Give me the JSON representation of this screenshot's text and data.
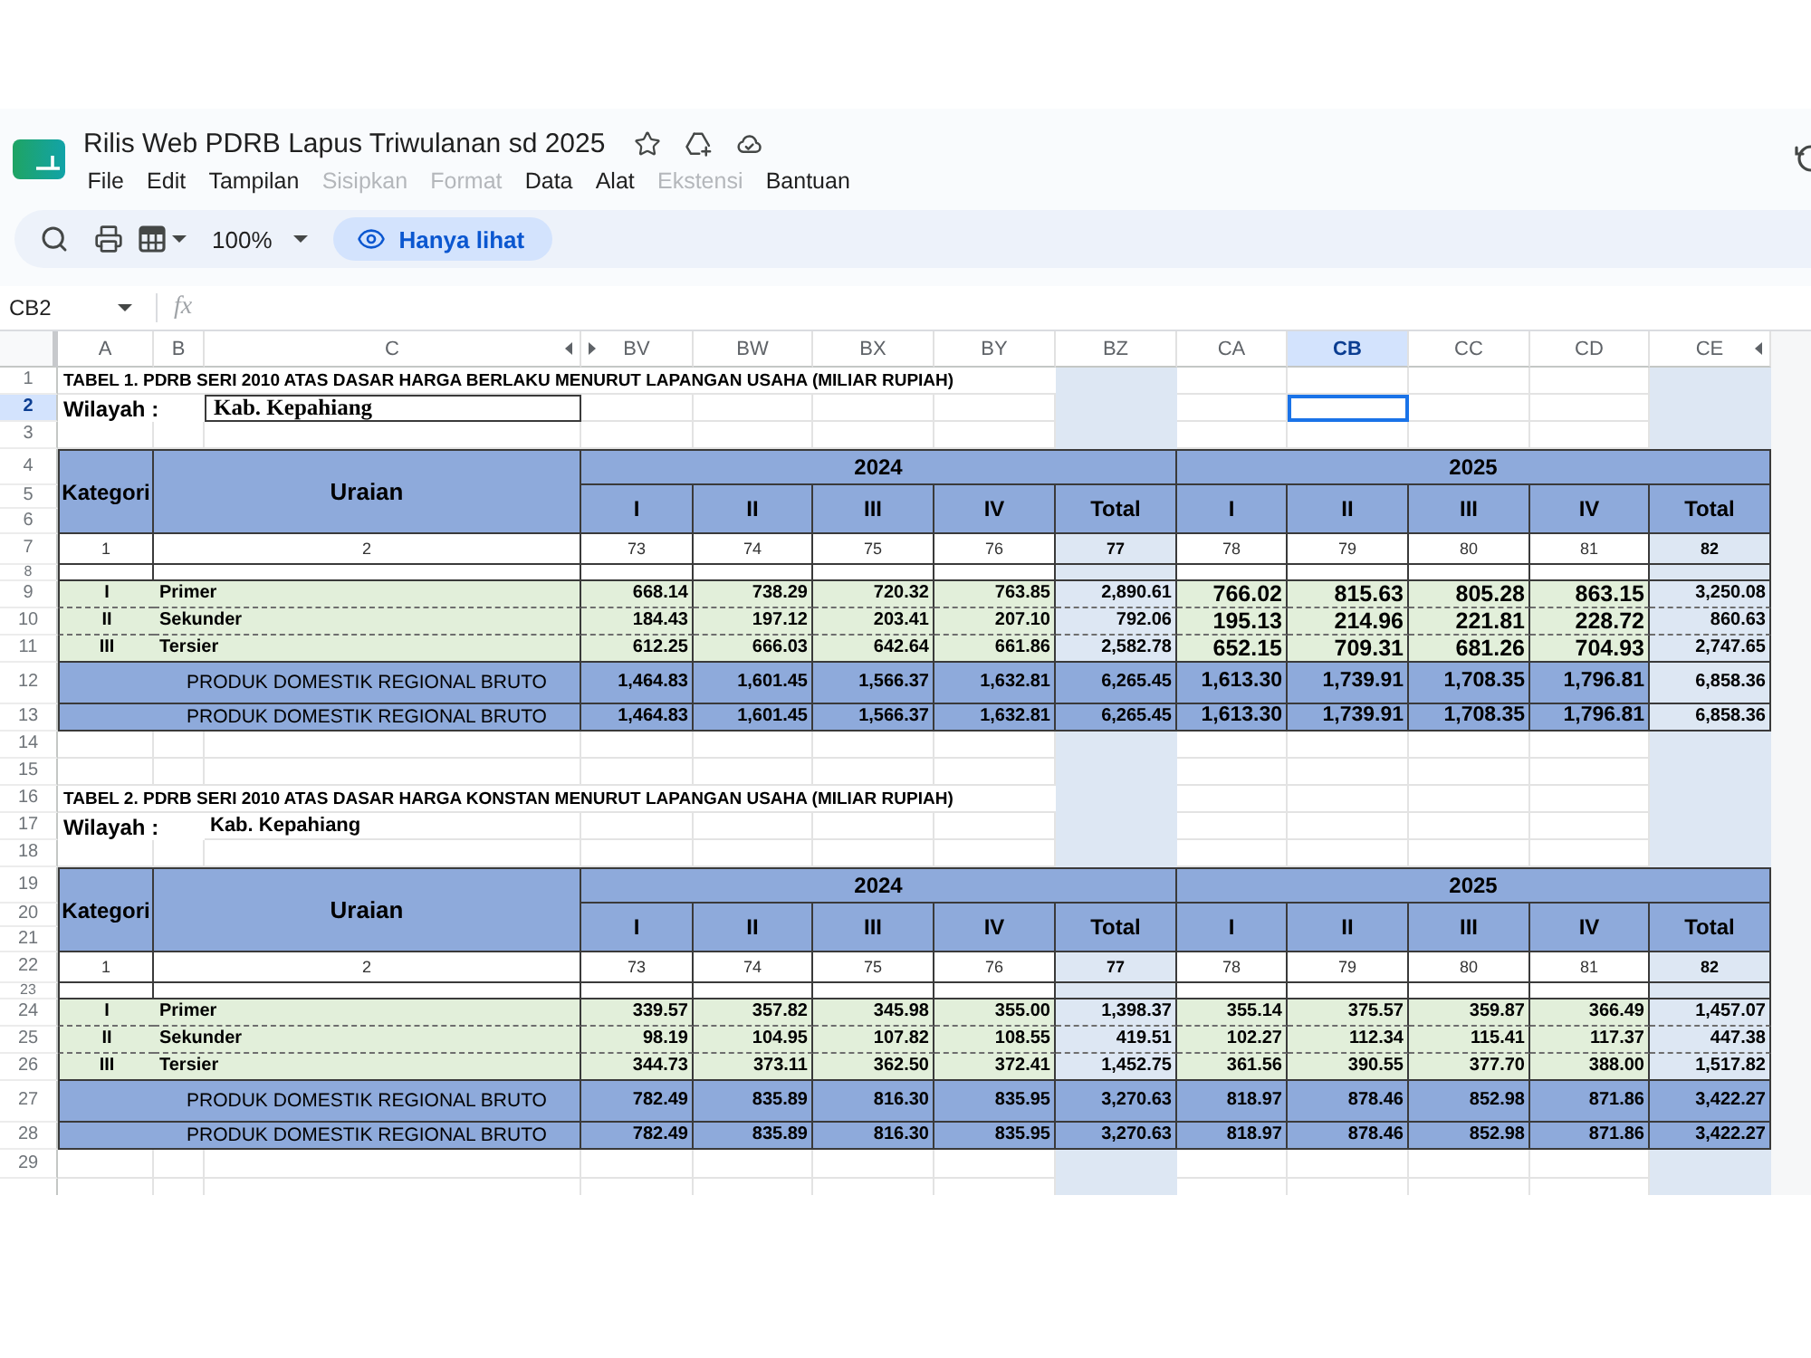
{
  "app": {
    "title": "Rilis Web PDRB Lapus Triwulanan sd 2025",
    "menu": [
      {
        "label": "File",
        "disabled": false
      },
      {
        "label": "Edit",
        "disabled": false
      },
      {
        "label": "Tampilan",
        "disabled": false
      },
      {
        "label": "Sisipkan",
        "disabled": true
      },
      {
        "label": "Format",
        "disabled": true
      },
      {
        "label": "Data",
        "disabled": false
      },
      {
        "label": "Alat",
        "disabled": false
      },
      {
        "label": "Ekstensi",
        "disabled": true
      },
      {
        "label": "Bantuan",
        "disabled": false
      }
    ]
  },
  "toolbar": {
    "zoom": "100%",
    "view_mode": "Hanya lihat"
  },
  "formula_bar": {
    "cell_ref": "CB2",
    "function_label": "fx"
  },
  "columns": [
    {
      "label": "A",
      "selected": false,
      "hidden_before": false,
      "hidden_after": false
    },
    {
      "label": "B",
      "selected": false,
      "hidden_before": false,
      "hidden_after": false
    },
    {
      "label": "C",
      "selected": false,
      "hidden_before": false,
      "hidden_after": true
    },
    {
      "label": "BV",
      "selected": false,
      "hidden_before": true,
      "hidden_after": false
    },
    {
      "label": "BW",
      "selected": false,
      "hidden_before": false,
      "hidden_after": false
    },
    {
      "label": "BX",
      "selected": false,
      "hidden_before": false,
      "hidden_after": false
    },
    {
      "label": "BY",
      "selected": false,
      "hidden_before": false,
      "hidden_after": false
    },
    {
      "label": "BZ",
      "selected": false,
      "hidden_before": false,
      "hidden_after": false
    },
    {
      "label": "CA",
      "selected": false,
      "hidden_before": false,
      "hidden_after": false
    },
    {
      "label": "CB",
      "selected": true,
      "hidden_before": false,
      "hidden_after": false
    },
    {
      "label": "CC",
      "selected": false,
      "hidden_before": false,
      "hidden_after": false
    },
    {
      "label": "CD",
      "selected": false,
      "hidden_before": false,
      "hidden_after": false
    },
    {
      "label": "CE",
      "selected": false,
      "hidden_before": false,
      "hidden_after": true
    }
  ],
  "row_headers": [
    {
      "label": "1",
      "selected": false
    },
    {
      "label": "2",
      "selected": true
    },
    {
      "label": "3",
      "selected": false
    },
    {
      "label": "4",
      "selected": false
    },
    {
      "label": "5",
      "selected": false
    },
    {
      "label": "6",
      "selected": false
    },
    {
      "label": "7",
      "selected": false
    },
    {
      "label": "8",
      "selected": false
    },
    {
      "label": "9",
      "selected": false
    },
    {
      "label": "10",
      "selected": false
    },
    {
      "label": "11",
      "selected": false
    },
    {
      "label": "12",
      "selected": false
    },
    {
      "label": "13",
      "selected": false
    },
    {
      "label": "14",
      "selected": false
    },
    {
      "label": "15",
      "selected": false
    },
    {
      "label": "16",
      "selected": false
    },
    {
      "label": "17",
      "selected": false
    },
    {
      "label": "18",
      "selected": false
    },
    {
      "label": "19",
      "selected": false
    },
    {
      "label": "20",
      "selected": false
    },
    {
      "label": "21",
      "selected": false
    },
    {
      "label": "22",
      "selected": false
    },
    {
      "label": "23",
      "selected": false
    },
    {
      "label": "24",
      "selected": false
    },
    {
      "label": "25",
      "selected": false
    },
    {
      "label": "26",
      "selected": false
    },
    {
      "label": "27",
      "selected": false
    },
    {
      "label": "28",
      "selected": false
    },
    {
      "label": "29",
      "selected": false
    }
  ],
  "tables": [
    {
      "title": "TABEL 1. PDRB SERI 2010 ATAS DASAR HARGA BERLAKU MENURUT LAPANGAN USAHA (MILIAR RUPIAH)",
      "region": {
        "kind": "boxed",
        "label": "Wilayah :",
        "value": "Kab. Kepahiang"
      },
      "header": {
        "category": "Kategori",
        "description": "Uraian",
        "years": [
          {
            "label": "2024",
            "quarters": [
              "I",
              "II",
              "III",
              "IV"
            ],
            "total": "Total",
            "large_values": false
          },
          {
            "label": "2025",
            "quarters": [
              "I",
              "II",
              "III",
              "IV"
            ],
            "total": "Total",
            "large_values": true
          }
        ]
      },
      "column_numbers": [
        "1",
        "2",
        "73",
        "74",
        "75",
        "76",
        "77",
        "78",
        "79",
        "80",
        "81",
        "82"
      ],
      "final_total_shaded": true,
      "rows": [
        {
          "kind": "sector",
          "category": "I",
          "name": "Primer",
          "values": [
            "668.14",
            "738.29",
            "720.32",
            "763.85",
            "2,890.61",
            "766.02",
            "815.63",
            "805.28",
            "863.15",
            "3,250.08"
          ]
        },
        {
          "kind": "sector",
          "category": "II",
          "name": "Sekunder",
          "values": [
            "184.43",
            "197.12",
            "203.41",
            "207.10",
            "792.06",
            "195.13",
            "214.96",
            "221.81",
            "228.72",
            "860.63"
          ]
        },
        {
          "kind": "sector",
          "category": "III",
          "name": "Tersier",
          "values": [
            "612.25",
            "666.03",
            "642.64",
            "661.86",
            "2,582.78",
            "652.15",
            "709.31",
            "681.26",
            "704.93",
            "2,747.65"
          ]
        },
        {
          "kind": "total",
          "name": "PRODUK DOMESTIK REGIONAL BRUTO",
          "values": [
            "1,464.83",
            "1,601.45",
            "1,566.37",
            "1,632.81",
            "6,265.45",
            "1,613.30",
            "1,739.91",
            "1,708.35",
            "1,796.81",
            "6,858.36"
          ]
        },
        {
          "kind": "total",
          "name": "PRODUK DOMESTIK REGIONAL BRUTO",
          "values": [
            "1,464.83",
            "1,601.45",
            "1,566.37",
            "1,632.81",
            "6,265.45",
            "1,613.30",
            "1,739.91",
            "1,708.35",
            "1,796.81",
            "6,858.36"
          ]
        }
      ]
    },
    {
      "title": "TABEL 2. PDRB SERI 2010 ATAS DASAR HARGA KONSTAN MENURUT LAPANGAN USAHA (MILIAR RUPIAH)",
      "region": {
        "kind": "plain",
        "label": "Wilayah :",
        "value": "Kab. Kepahiang"
      },
      "header": {
        "category": "Kategori",
        "description": "Uraian",
        "years": [
          {
            "label": "2024",
            "quarters": [
              "I",
              "II",
              "III",
              "IV"
            ],
            "total": "Total",
            "large_values": false
          },
          {
            "label": "2025",
            "quarters": [
              "I",
              "II",
              "III",
              "IV"
            ],
            "total": "Total",
            "large_values": false
          }
        ]
      },
      "column_numbers": [
        "1",
        "2",
        "73",
        "74",
        "75",
        "76",
        "77",
        "78",
        "79",
        "80",
        "81",
        "82"
      ],
      "final_total_shaded": false,
      "rows": [
        {
          "kind": "sector",
          "category": "I",
          "name": "Primer",
          "values": [
            "339.57",
            "357.82",
            "345.98",
            "355.00",
            "1,398.37",
            "355.14",
            "375.57",
            "359.87",
            "366.49",
            "1,457.07"
          ]
        },
        {
          "kind": "sector",
          "category": "II",
          "name": "Sekunder",
          "values": [
            "98.19",
            "104.95",
            "107.82",
            "108.55",
            "419.51",
            "102.27",
            "112.34",
            "115.41",
            "117.37",
            "447.38"
          ]
        },
        {
          "kind": "sector",
          "category": "III",
          "name": "Tersier",
          "values": [
            "344.73",
            "373.11",
            "362.50",
            "372.41",
            "1,452.75",
            "361.56",
            "390.55",
            "377.70",
            "388.00",
            "1,517.82"
          ]
        },
        {
          "kind": "total",
          "name": "PRODUK DOMESTIK REGIONAL BRUTO",
          "values": [
            "782.49",
            "835.89",
            "816.30",
            "835.95",
            "3,270.63",
            "818.97",
            "878.46",
            "852.98",
            "871.86",
            "3,422.27"
          ]
        },
        {
          "kind": "total",
          "name": "PRODUK DOMESTIK REGIONAL BRUTO",
          "values": [
            "782.49",
            "835.89",
            "816.30",
            "835.95",
            "3,270.63",
            "818.97",
            "878.46",
            "852.98",
            "871.86",
            "3,422.27"
          ]
        }
      ]
    }
  ]
}
